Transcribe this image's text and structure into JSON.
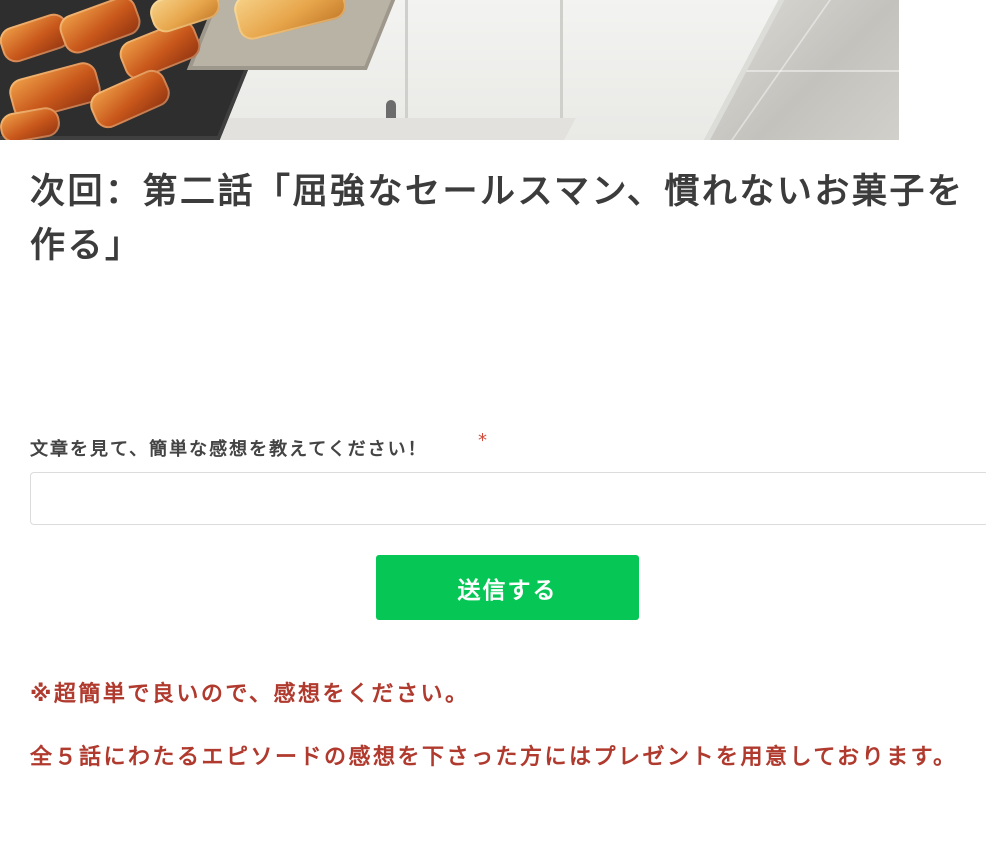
{
  "hero": {
    "image_name": "sweets-shelf-photo"
  },
  "article": {
    "next_episode_title": "次回：第二話「屈強なセールスマン、慣れないお菓子を作る」"
  },
  "form": {
    "label": "文章を見て、簡単な感想を教えてください！",
    "required_mark": "*",
    "input_value": "",
    "submit_label": "送信する"
  },
  "notes": {
    "line1": "※超簡単で良いので、感想をください。",
    "line2": "全５話にわたるエピソードの感想を下さった方にはプレゼントを用意しております。"
  },
  "colors": {
    "submit_bg": "#06c755",
    "note_text": "#b03a2e",
    "required": "#d64b3a"
  }
}
